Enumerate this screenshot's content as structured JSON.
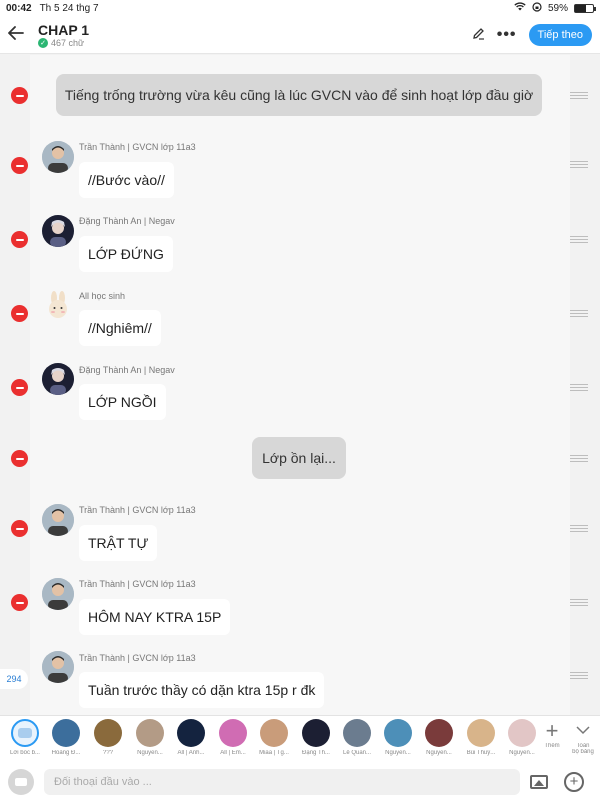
{
  "status_bar": {
    "time": "00:42",
    "date": "Th 5 24 thg 7",
    "battery": "59%",
    "battery_level": 0.59
  },
  "header": {
    "title": "CHAP 1",
    "word_count": "467 chữ",
    "next_label": "Tiếp theo",
    "icons": [
      "back-arrow-icon",
      "check-icon",
      "pencil-icon",
      "more-icon"
    ]
  },
  "messages": [
    {
      "type": "narration",
      "text": "Tiếng trống trường vừa kêu cũng là lúc GVCN vào để sinh hoạt lớp đầu giờ"
    },
    {
      "type": "dialog",
      "speaker": "Trần Thành | GVCN lớp 11a3",
      "text": "//Bước vào//"
    },
    {
      "type": "dialog",
      "speaker": "Đặng Thành An | Negav",
      "text": "LỚP ĐỨNG"
    },
    {
      "type": "dialog",
      "speaker": "All học sinh",
      "text": "//Nghiêm//"
    },
    {
      "type": "dialog",
      "speaker": "Đặng Thành An | Negav",
      "text": "LỚP NGỒI"
    },
    {
      "type": "narration",
      "text": "Lớp ồn lại..."
    },
    {
      "type": "dialog",
      "speaker": "Trần Thành | GVCN lớp 11a3",
      "text": "TRẬT TỰ"
    },
    {
      "type": "dialog",
      "speaker": "Trần Thành | GVCN lớp 11a3",
      "text": "HÔM NAY KTRA 15P"
    },
    {
      "type": "dialog",
      "speaker": "Trần Thành | GVCN lớp 11a3",
      "text": "Tuần trước thầy có dặn ktra 15p r đk"
    }
  ],
  "count_badge": "294",
  "characters": [
    {
      "name": "Lời bốc b..."
    },
    {
      "name": "Hoàng Đ..."
    },
    {
      "name": "???"
    },
    {
      "name": "Nguyễn..."
    },
    {
      "name": "All | Anh..."
    },
    {
      "name": "All | Em..."
    },
    {
      "name": "Miaa | Tg..."
    },
    {
      "name": "Đặng Th..."
    },
    {
      "name": "Lê Quan..."
    },
    {
      "name": "Nguyễn..."
    },
    {
      "name": "Nguyễn..."
    },
    {
      "name": "Bùi Thuỷ..."
    },
    {
      "name": "Nguyễn..."
    }
  ],
  "add_label": "Thêm",
  "expand_label_1": "Toàn",
  "expand_label_2": "bộ bảng",
  "input": {
    "placeholder": "Đối thoại đầu vào ..."
  },
  "colors": {
    "accent": "#2b9af3",
    "remove": "#ea2f2f",
    "narration_bg": "#d7d7d7",
    "bubble_bg": "#ffffff"
  }
}
